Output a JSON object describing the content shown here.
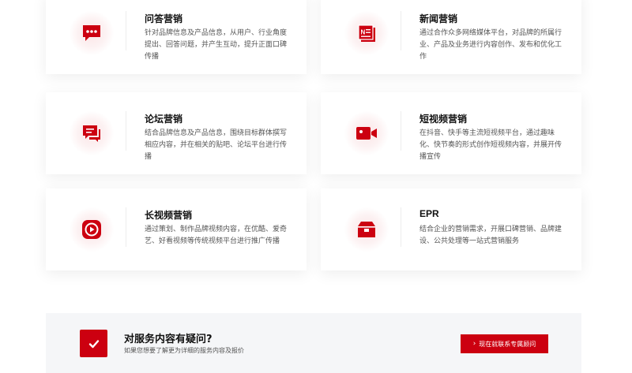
{
  "cards": [
    {
      "title": "问答营销",
      "desc": "针对品牌信息及产品信息，从用户、行业角度提出、回答问题，并产生互动，提升正面口碑传播",
      "icon": "chat-bubble-icon"
    },
    {
      "title": "新闻营销",
      "desc": "通过合作众多网络媒体平台，对品牌的所属行业、产品及业务进行内容创作、发布和优化工作",
      "icon": "news-icon"
    },
    {
      "title": "论坛营销",
      "desc": "结合品牌信息及产品信息，围绕目标群体撰写相应内容，并在相关的贴吧、论坛平台进行传播",
      "icon": "forum-icon"
    },
    {
      "title": "短视频营销",
      "desc": "在抖音、快手等主流短视频平台，通过趣味化、快节奏的形式创作短视频内容，并展开传播宣传",
      "icon": "video-camera-icon"
    },
    {
      "title": "长视频营销",
      "desc": "通过策划、制作品牌视频内容，在优酷、爱奇艺、好看视频等传统视频平台进行推广传播",
      "icon": "play-icon"
    },
    {
      "title": "EPR",
      "desc": "结合企业的营销需求，开展口碑营销、品牌建设、公共处理等一站式营销服务",
      "icon": "box-icon"
    }
  ],
  "cta": {
    "title": "对服务内容有疑问?",
    "subtitle": "如果您想要了解更为详细的服务内容及报价",
    "button_label": "现在就联系专属顾问",
    "icon": "check-icon"
  },
  "colors": {
    "accent": "#cc0010",
    "bar_bg": "#f5f6f8"
  }
}
